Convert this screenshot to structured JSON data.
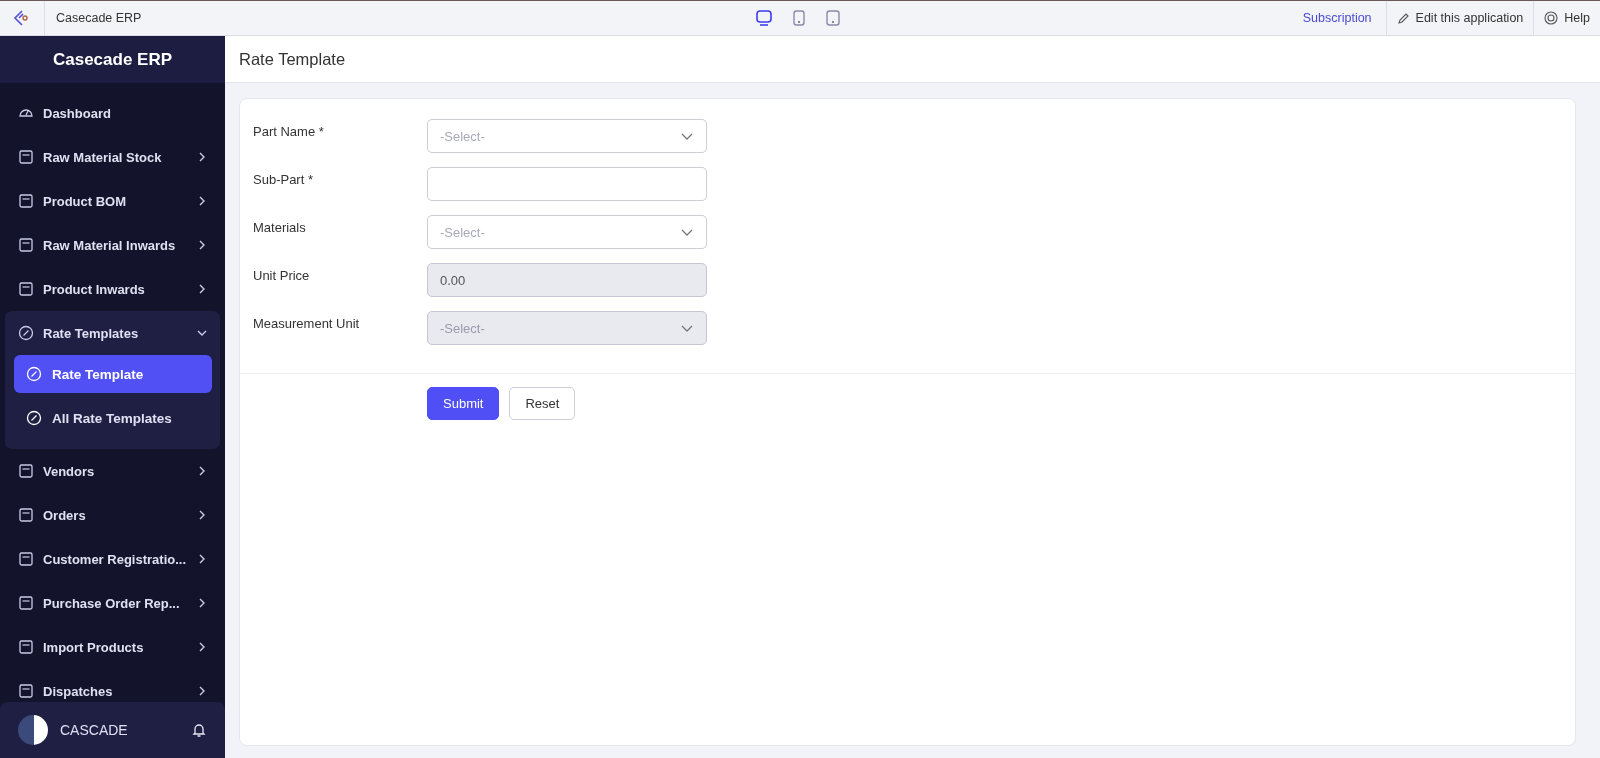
{
  "topbar": {
    "app_name": "Casecade ERP",
    "devices": [
      {
        "selected": true
      },
      {
        "selected": false
      },
      {
        "selected": false
      }
    ],
    "links": [
      "Subscription",
      "Edit this application",
      "Help"
    ]
  },
  "sidebar": {
    "title": "Casecade ERP",
    "items": [
      {
        "label": "Dashboard"
      },
      {
        "label": "Raw Material Stock",
        "expanded": false
      },
      {
        "label": "Product BOM",
        "expanded": false
      },
      {
        "label": "Raw Material Inwards",
        "expanded": false
      },
      {
        "label": "Product Inwards",
        "expanded": false
      },
      {
        "label": "Rate Templates",
        "expanded": true,
        "children": [
          {
            "label": "Rate Template",
            "selected": true
          },
          {
            "label": "All Rate Templates",
            "selected": false
          }
        ]
      },
      {
        "label": "Vendors",
        "expanded": false
      },
      {
        "label": "Orders",
        "expanded": false
      },
      {
        "label": "Customer Registratio...",
        "expanded": false
      },
      {
        "label": "Purchase Order Rep...",
        "expanded": false
      },
      {
        "label": "Import Products",
        "expanded": false
      },
      {
        "label": "Dispatches",
        "expanded": false
      }
    ],
    "user": {
      "name": "CASCADE"
    }
  },
  "page": {
    "title": "Rate Template"
  },
  "form": {
    "fields": [
      {
        "label": "Part Name *",
        "kind": "select",
        "placeholder": "-Select-",
        "disabled": false
      },
      {
        "label": "Sub-Part *",
        "kind": "text",
        "disabled": false
      },
      {
        "label": "Materials",
        "kind": "select",
        "placeholder": "-Select-",
        "disabled": false
      },
      {
        "label": "Unit Price",
        "kind": "text",
        "value": "0.00",
        "disabled": true
      },
      {
        "label": "Measurement Unit",
        "kind": "select",
        "placeholder": "-Select-",
        "disabled": true
      }
    ],
    "buttons": [
      {
        "label": "Submit",
        "kind": "primary"
      },
      {
        "label": "Reset",
        "kind": "secondary"
      }
    ]
  }
}
